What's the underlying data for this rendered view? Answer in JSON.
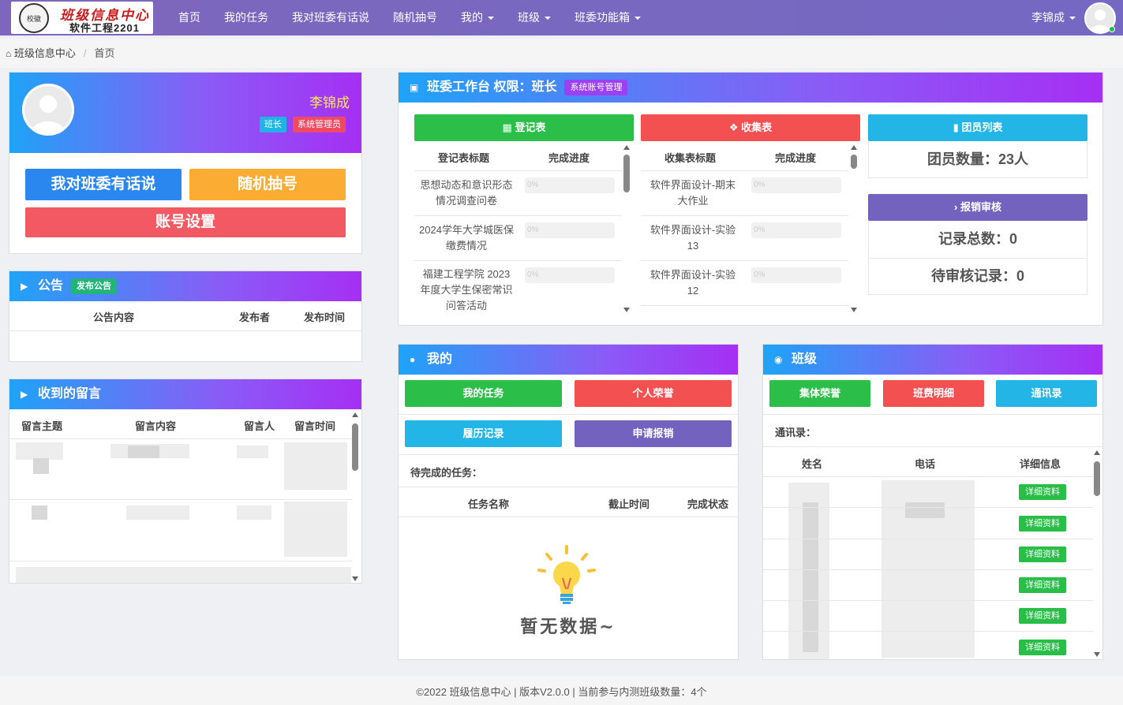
{
  "navbar": {
    "logo_title": "班级信息中心",
    "logo_subtitle": "软件工程2201",
    "logo_emblem": "校徽",
    "menu": [
      {
        "label": "首页"
      },
      {
        "label": "我的任务"
      },
      {
        "label": "我对班委有话说"
      },
      {
        "label": "随机抽号"
      },
      {
        "label": "我的"
      },
      {
        "label": "班级"
      },
      {
        "label": "班委功能箱"
      }
    ],
    "user_name": "李锦成"
  },
  "breadcrumb": {
    "home": "班级信息中心",
    "sep": "/",
    "current": "首页"
  },
  "profile": {
    "name": "李锦成",
    "badge_role": "班长",
    "badge_admin": "系统管理员",
    "btn_talk": "我对班委有话说",
    "btn_random": "随机抽号",
    "btn_account": "账号设置"
  },
  "notice": {
    "title": "公告",
    "publish_btn": "发布公告",
    "columns": [
      "公告内容",
      "发布者",
      "发布时间"
    ]
  },
  "messages": {
    "title": "收到的留言",
    "columns": [
      "留言主题",
      "留言内容",
      "留言人",
      "留言时间"
    ]
  },
  "workbench": {
    "title": "班委工作台 权限：班长",
    "sys_btn": "系统账号管理",
    "register": {
      "header": "登记表",
      "columns": [
        "登记表标题",
        "完成进度"
      ],
      "rows": [
        {
          "title": "思想动态和意识形态情况调查问卷",
          "progress": "0%"
        },
        {
          "title": "2024学年大学城医保缴费情况",
          "progress": "0%"
        },
        {
          "title": "福建工程学院 2023 年度大学生保密常识问答活动",
          "progress": "0%"
        }
      ]
    },
    "collect": {
      "header": "收集表",
      "columns": [
        "收集表标题",
        "完成进度"
      ],
      "rows": [
        {
          "title": "软件界面设计-期末大作业",
          "progress": "0%"
        },
        {
          "title": "软件界面设计-实验13",
          "progress": "0%"
        },
        {
          "title": "软件界面设计-实验12",
          "progress": "0%"
        }
      ]
    },
    "members": {
      "header": "团员列表",
      "count_text": "团员数量：23人"
    },
    "reimburse": {
      "header": "报销审核",
      "total": "记录总数：0",
      "pending": "待审核记录：0"
    }
  },
  "mine": {
    "title": "我的",
    "buttons": [
      "我的任务",
      "个人荣誉",
      "履历记录",
      "申请报销"
    ],
    "pending_label": "待完成的任务：",
    "columns": [
      "任务名称",
      "截止时间",
      "完成状态"
    ],
    "empty_text": "暂无数据~"
  },
  "class": {
    "title": "班级",
    "buttons": [
      "集体荣誉",
      "班费明细",
      "通讯录"
    ],
    "contacts_label": "通讯录：",
    "columns": [
      "姓名",
      "电话",
      "详细信息"
    ],
    "detail_btn": "详细资料",
    "detail_rows": 6
  },
  "footer": {
    "text": "©2022 班级信息中心 | 版本V2.0.0 | 当前参与内测班级数量：4个"
  },
  "colors": {
    "nav_bg": "#7468c3",
    "blue": "#2b87f0",
    "orange": "#fbad33",
    "red": "#f25562",
    "green": "#2bbe48",
    "cyan": "#23b5e6",
    "purple": "#7462bf",
    "teal": "#21b57a"
  }
}
